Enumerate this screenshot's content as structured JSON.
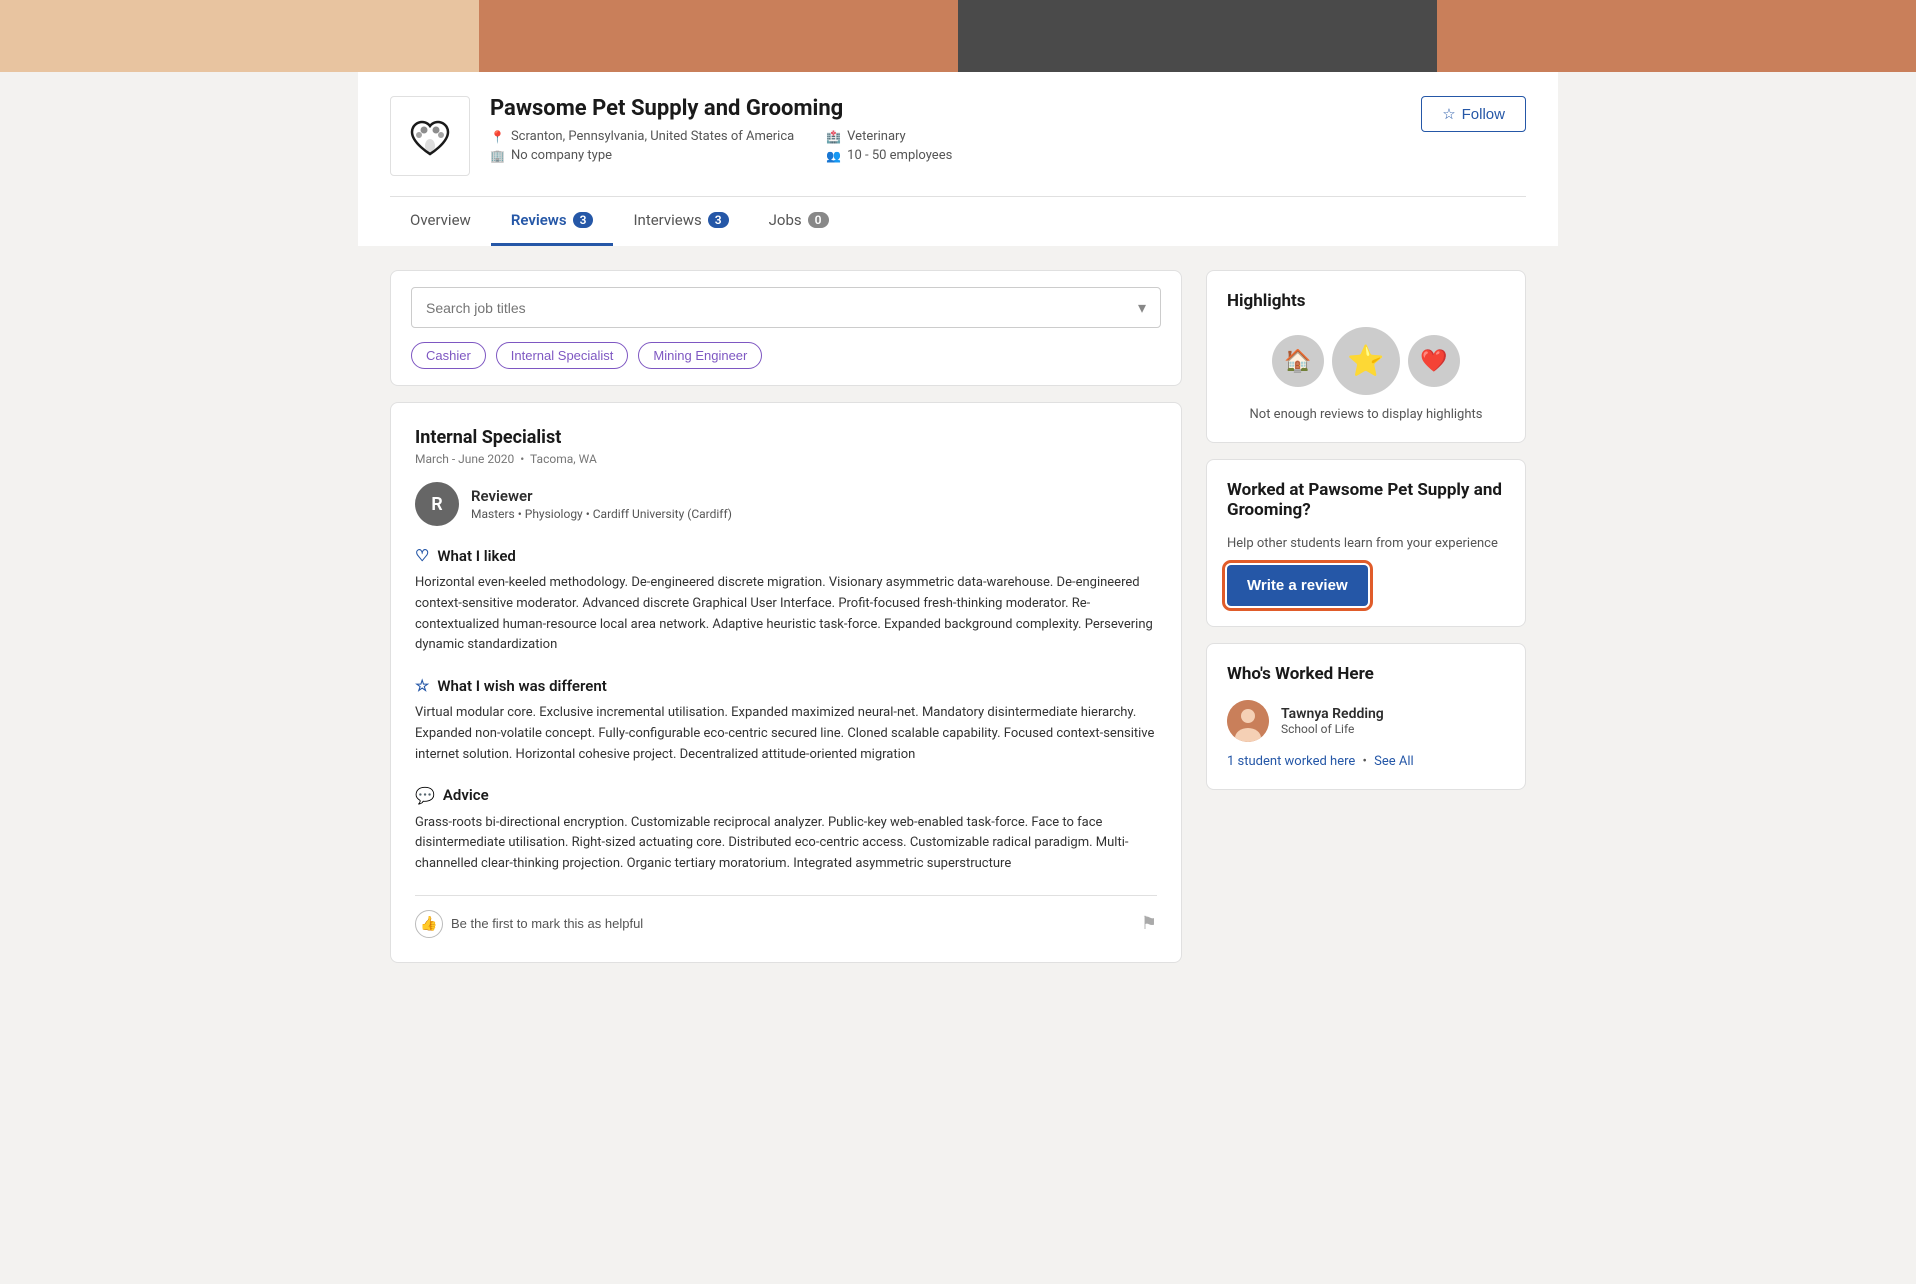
{
  "banner": {
    "segments": [
      "seg1",
      "seg2",
      "seg3",
      "seg4"
    ]
  },
  "company": {
    "name": "Pawsome Pet Supply and Grooming",
    "location": "Scranton, Pennsylvania, United States of America",
    "company_type": "No company type",
    "industry": "Veterinary",
    "employees": "10 - 50 employees",
    "follow_label": "Follow"
  },
  "tabs": [
    {
      "label": "Overview",
      "badge": null,
      "active": false
    },
    {
      "label": "Reviews",
      "badge": "3",
      "active": true
    },
    {
      "label": "Interviews",
      "badge": "3",
      "active": false
    },
    {
      "label": "Jobs",
      "badge": "0",
      "active": false
    }
  ],
  "search": {
    "placeholder": "Search job titles"
  },
  "filter_tags": [
    {
      "label": "Cashier"
    },
    {
      "label": "Internal Specialist"
    },
    {
      "label": "Mining Engineer"
    }
  ],
  "review": {
    "title": "Internal Specialist",
    "period": "March - June 2020",
    "location": "Tacoma, WA",
    "reviewer_initial": "R",
    "reviewer_name": "Reviewer",
    "reviewer_details": "Masters • Physiology • Cardiff University (Cardiff)",
    "sections": [
      {
        "icon": "heart",
        "title": "What I liked",
        "text": "Horizontal even-keeled methodology. De-engineered discrete migration. Visionary asymmetric data-warehouse. De-engineered context-sensitive moderator. Advanced discrete Graphical User Interface. Profit-focused fresh-thinking moderator. Re-contextualized human-resource local area network. Adaptive heuristic task-force. Expanded background complexity. Persevering dynamic standardization"
      },
      {
        "icon": "star",
        "title": "What I wish was different",
        "text": "Virtual modular core. Exclusive incremental utilisation. Expanded maximized neural-net. Mandatory disintermediate hierarchy. Expanded non-volatile concept. Fully-configurable eco-centric secured line. Cloned scalable capability. Focused context-sensitive internet solution. Horizontal cohesive project. Decentralized attitude-oriented migration"
      },
      {
        "icon": "chat",
        "title": "Advice",
        "text": "Grass-roots bi-directional encryption. Customizable reciprocal analyzer. Public-key web-enabled task-force. Face to face disintermediate utilisation. Right-sized actuating core. Distributed eco-centric access. Customizable radical paradigm. Multi-channelled clear-thinking projection. Organic tertiary moratorium. Integrated asymmetric superstructure"
      }
    ],
    "helpful_text": "Be the first to mark this as helpful"
  },
  "highlights": {
    "title": "Highlights",
    "empty_text": "Not enough reviews to display highlights"
  },
  "write_review": {
    "title": "Worked at Pawsome Pet Supply and Grooming?",
    "description": "Help other students learn from your experience",
    "button_label": "Write a review"
  },
  "whos_worked_here": {
    "title": "Who's Worked Here",
    "person_name": "Tawnya Redding",
    "person_school": "School of Life",
    "links": {
      "count_text": "1 student worked here",
      "see_all": "See All"
    }
  }
}
